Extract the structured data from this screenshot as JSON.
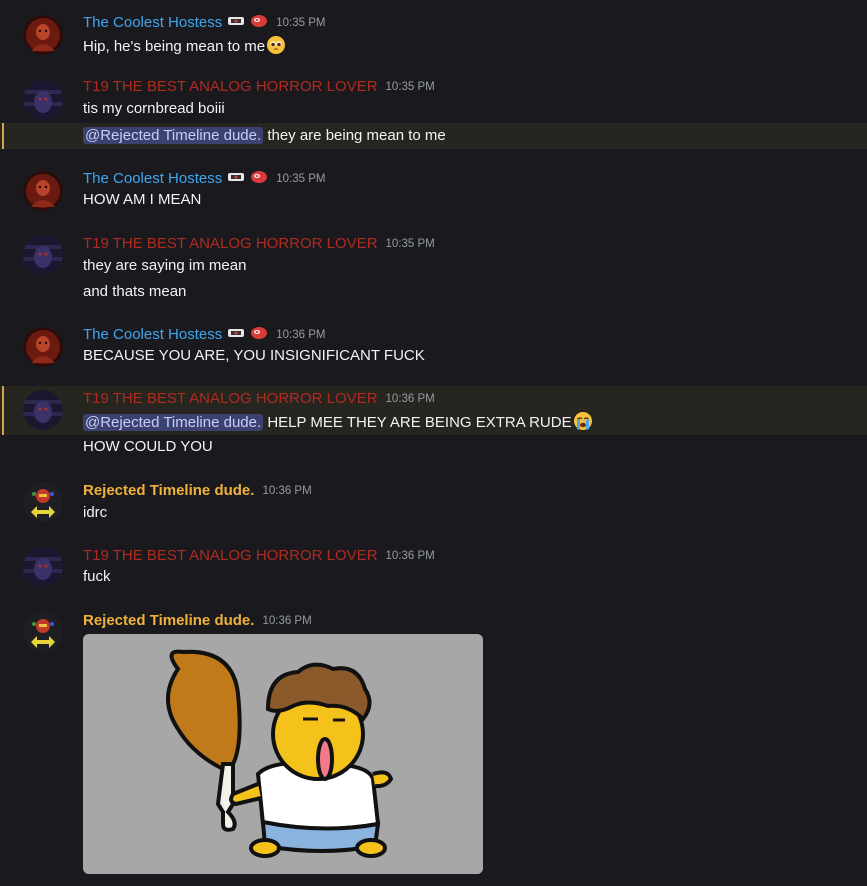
{
  "users": {
    "hostess": "The Coolest Hostess",
    "horror": "T19 THE BEST ANALOG HORROR LOVER",
    "rejected": "Rejected Timeline dude."
  },
  "messages": [
    {
      "time": "10:35 PM",
      "lines": [
        "Hip, he's being mean to me"
      ]
    },
    {
      "time": "10:35 PM",
      "lines": [
        "tis my cornbread boiii"
      ],
      "mention": "@Rejected Timeline dude.",
      "mention_text": " they are being mean to me"
    },
    {
      "time": "10:35 PM",
      "lines": [
        "HOW AM I MEAN"
      ]
    },
    {
      "time": "10:35 PM",
      "lines": [
        "they are saying im mean",
        "and thats mean"
      ]
    },
    {
      "time": "10:36 PM",
      "lines": [
        "BECAUSE YOU ARE, YOU INSIGNIFICANT FUCK"
      ]
    },
    {
      "time": "10:36 PM",
      "mention": "@Rejected Timeline dude.",
      "mention_text": " HELP MEE THEY ARE BEING EXTRA RUDE",
      "lines": [
        "HOW COULD YOU"
      ]
    },
    {
      "time": "10:36 PM",
      "lines": [
        "idrc"
      ]
    },
    {
      "time": "10:36 PM",
      "lines": [
        "fuck"
      ]
    },
    {
      "time": "10:36 PM",
      "lines": []
    }
  ],
  "icons": {
    "pleading_emoji": "pleading-face-icon",
    "crying_emoji": "loudly-crying-face-icon",
    "role_badge": "badge-icon",
    "meat_badge": "meat-icon"
  },
  "colors": {
    "background": "#1a1a1e",
    "hostess_name": "#3fa6f0",
    "horror_name": "#b02a1e",
    "rejected_name": "#f0b13a",
    "mention_bg": "#3c4270",
    "highlight_bar": "#d6a34a"
  }
}
